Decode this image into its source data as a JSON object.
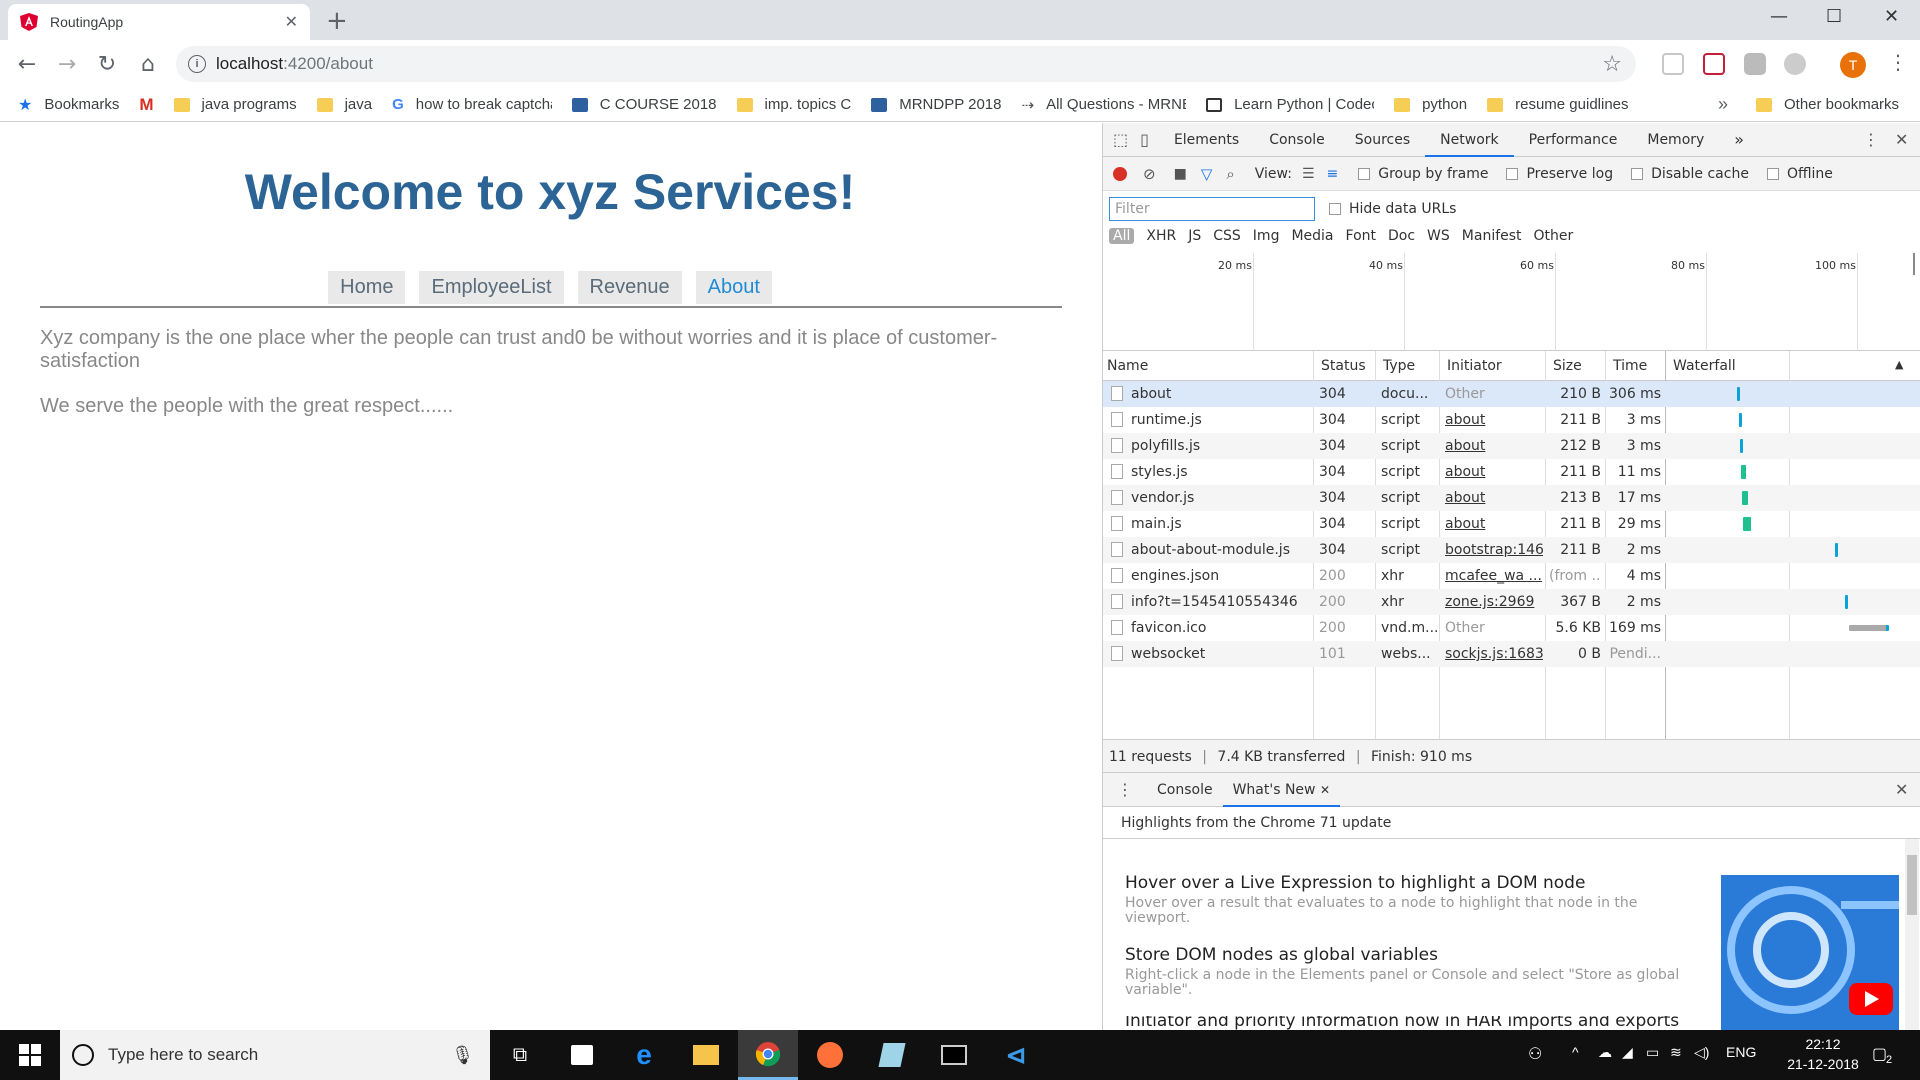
{
  "browser": {
    "tab_title": "RoutingApp",
    "url_host": "localhost",
    "url_path": ":4200/about",
    "avatar_letter": "T",
    "bookmarks": [
      {
        "label": "Bookmarks",
        "icon": "star-icon"
      },
      {
        "label": "",
        "icon": "gmail-icon"
      },
      {
        "label": "java programs",
        "icon": "folder-icon"
      },
      {
        "label": "java",
        "icon": "folder-icon"
      },
      {
        "label": "how to break captcha",
        "icon": "google-icon"
      },
      {
        "label": "C COURSE 2018",
        "icon": "p-icon"
      },
      {
        "label": "imp. topics C",
        "icon": "folder-icon"
      },
      {
        "label": "MRNDPP 2018",
        "icon": "p-icon"
      },
      {
        "label": "All Questions - MRNE",
        "icon": "dash-icon"
      },
      {
        "label": "Learn Python | Codec",
        "icon": "codecademy-icon"
      },
      {
        "label": "python",
        "icon": "folder-icon"
      },
      {
        "label": "resume guidlines",
        "icon": "folder-icon"
      }
    ],
    "bookmarks_more": "»",
    "other_bookmarks": "Other bookmarks"
  },
  "page": {
    "heading": "Welcome to xyz Services!",
    "nav": [
      "Home",
      "EmployeeList",
      "Revenue",
      "About"
    ],
    "active_nav": "About",
    "paragraph1": "Xyz company is the one place wher the people can trust and0 be without worries and it is place of customer-satisfaction",
    "paragraph2": "We serve the people with the great respect......"
  },
  "devtools": {
    "tabs": [
      "Elements",
      "Console",
      "Sources",
      "Network",
      "Performance",
      "Memory"
    ],
    "active_tab": "Network",
    "overflow": "»",
    "toolbar": {
      "view_label": "View:",
      "group_by_frame": "Group by frame",
      "preserve_log": "Preserve log",
      "disable_cache": "Disable cache",
      "offline": "Offline"
    },
    "filter_placeholder": "Filter",
    "hide_data_urls": "Hide data URLs",
    "type_filters": [
      "All",
      "XHR",
      "JS",
      "CSS",
      "Img",
      "Media",
      "Font",
      "Doc",
      "WS",
      "Manifest",
      "Other"
    ],
    "timeline_labels": [
      "20 ms",
      "40 ms",
      "60 ms",
      "80 ms",
      "100 ms"
    ],
    "columns": [
      "Name",
      "Status",
      "Type",
      "Initiator",
      "Size",
      "Time",
      "Waterfall"
    ],
    "requests": [
      {
        "name": "about",
        "status": "304",
        "type": "docu...",
        "initiator": "Other",
        "size": "210 B",
        "time": "306 ms"
      },
      {
        "name": "runtime.js",
        "status": "304",
        "type": "script",
        "initiator": "about",
        "size": "211 B",
        "time": "3 ms"
      },
      {
        "name": "polyfills.js",
        "status": "304",
        "type": "script",
        "initiator": "about",
        "size": "212 B",
        "time": "3 ms"
      },
      {
        "name": "styles.js",
        "status": "304",
        "type": "script",
        "initiator": "about",
        "size": "211 B",
        "time": "11 ms"
      },
      {
        "name": "vendor.js",
        "status": "304",
        "type": "script",
        "initiator": "about",
        "size": "213 B",
        "time": "17 ms"
      },
      {
        "name": "main.js",
        "status": "304",
        "type": "script",
        "initiator": "about",
        "size": "211 B",
        "time": "29 ms"
      },
      {
        "name": "about-about-module.js",
        "status": "304",
        "type": "script",
        "initiator": "bootstrap:146",
        "size": "211 B",
        "time": "2 ms"
      },
      {
        "name": "engines.json",
        "status": "200",
        "type": "xhr",
        "initiator": "mcafee_wa ...",
        "size": "(from ...",
        "time": "4 ms"
      },
      {
        "name": "info?t=1545410554346",
        "status": "200",
        "type": "xhr",
        "initiator": "zone.js:2969",
        "size": "367 B",
        "time": "2 ms"
      },
      {
        "name": "favicon.ico",
        "status": "200",
        "type": "vnd.m...",
        "initiator": "Other",
        "size": "5.6 KB",
        "time": "169 ms"
      },
      {
        "name": "websocket",
        "status": "101",
        "type": "webs...",
        "initiator": "sockjs.js:1683",
        "size": "0 B",
        "time": "Pendi..."
      }
    ],
    "summary_requests": "11 requests",
    "summary_transferred": "7.4 KB transferred",
    "summary_finish": "Finish: 910 ms",
    "summary_sep": "|",
    "drawer_tabs": [
      "Console",
      "What's New"
    ],
    "drawer_header": "Highlights from the Chrome 71 update",
    "whats_new": [
      {
        "title": "Hover over a Live Expression to highlight a DOM node",
        "desc": "Hover over a result that evaluates to a node to highlight that node in the viewport."
      },
      {
        "title": "Store DOM nodes as global variables",
        "desc": "Right-click a node in the Elements panel or Console and select \"Store as global variable\"."
      },
      {
        "title": "Initiator and priority information now in HAR imports and exports",
        "desc": ""
      }
    ]
  },
  "taskbar": {
    "search_placeholder": "Type here to search",
    "language": "ENG",
    "time": "22:12",
    "date": "21-12-2018",
    "notification_count": "2"
  }
}
